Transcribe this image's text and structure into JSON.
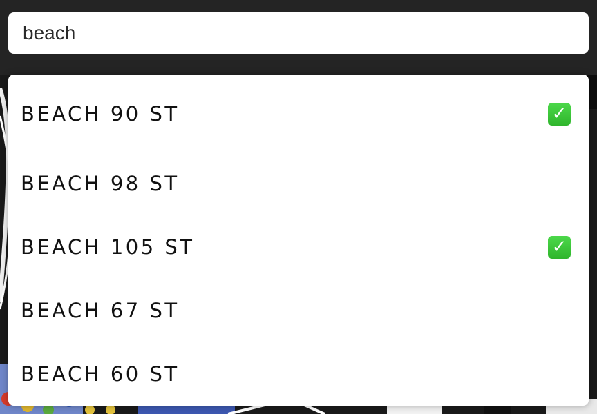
{
  "search": {
    "value": "beach"
  },
  "results": [
    {
      "label": "BEACH 90 ST",
      "checked": true
    },
    {
      "label": "BEACH 98 ST",
      "checked": false
    },
    {
      "label": "BEACH 105 ST",
      "checked": true
    },
    {
      "label": "BEACH 67 ST",
      "checked": false
    },
    {
      "label": "BEACH 60 ST",
      "checked": false
    }
  ],
  "icons": {
    "check": "check-mark-button-icon"
  },
  "colors": {
    "background": "#242424",
    "check_green": "#3cc63a"
  }
}
